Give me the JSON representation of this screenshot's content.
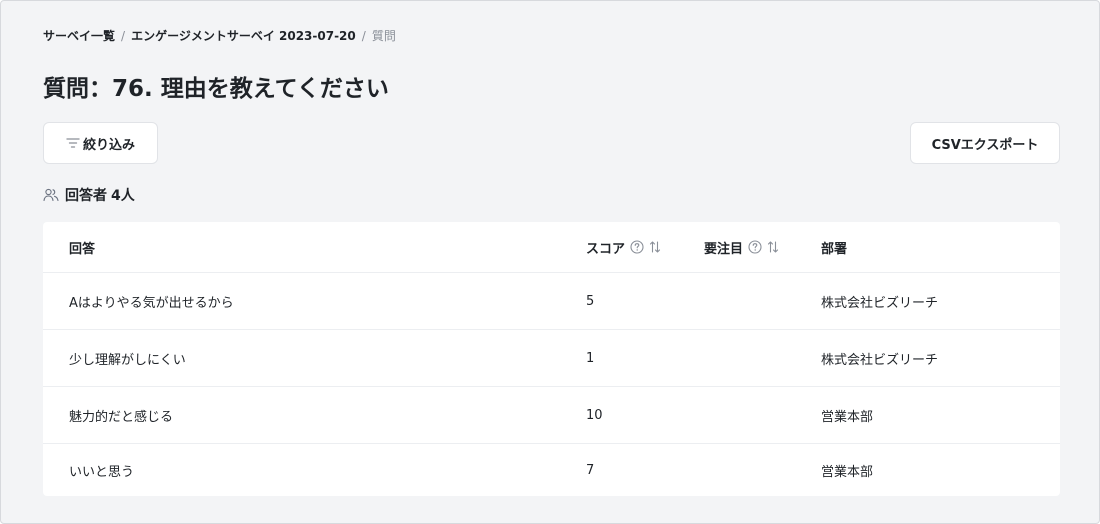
{
  "breadcrumb": {
    "items": [
      "サーベイ一覧",
      "エンゲージメントサーベイ 2023-07-20"
    ],
    "current": "質問",
    "separator": "/"
  },
  "page": {
    "title": "質問：76. 理由を教えてください"
  },
  "toolbar": {
    "filter_label": "絞り込み",
    "export_label": "CSVエクスポート"
  },
  "respondents": {
    "label": "回答者",
    "count": "4人"
  },
  "table": {
    "columns": {
      "answer": "回答",
      "score": "スコア",
      "attention": "要注目",
      "department": "部署"
    },
    "rows": [
      {
        "answer": "Aはよりやる気が出せるから",
        "score": "5",
        "attention": "",
        "department": "株式会社ビズリーチ"
      },
      {
        "answer": "少し理解がしにくい",
        "score": "1",
        "attention": "",
        "department": "株式会社ビズリーチ"
      },
      {
        "answer": "魅力的だと感じる",
        "score": "10",
        "attention": "",
        "department": "営業本部"
      },
      {
        "answer": "いいと思う",
        "score": "7",
        "attention": "",
        "department": "営業本部"
      }
    ]
  },
  "colors": {
    "background": "#f3f4f6",
    "card": "#ffffff",
    "text": "#1f2328",
    "muted": "#8a8f98",
    "divider": "#eceef1"
  }
}
